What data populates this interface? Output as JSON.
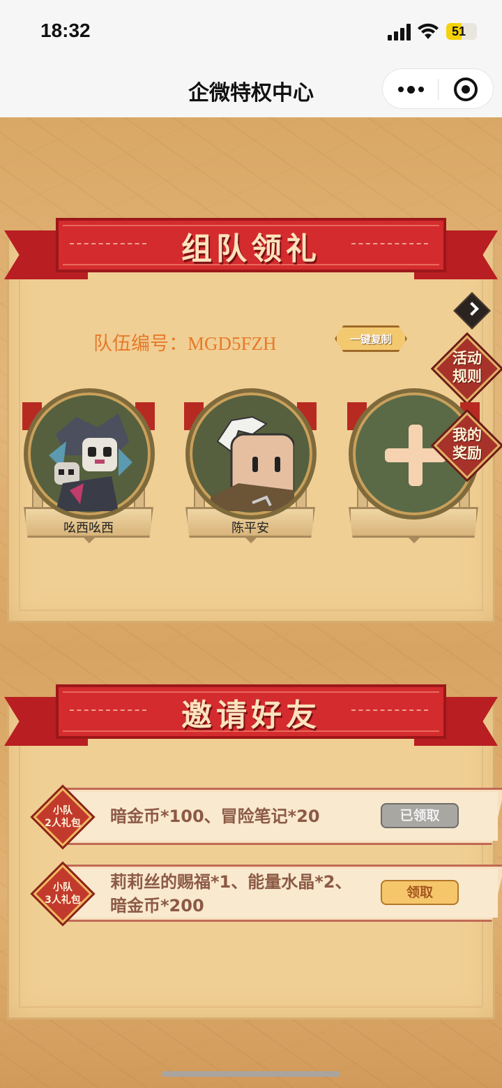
{
  "status_bar": {
    "time": "18:32",
    "battery": "51",
    "battery_level": 0.51
  },
  "nav": {
    "title": "企微特权中心"
  },
  "section_team": {
    "heading": "组队领礼",
    "team_code_label": "队伍编号：MGD5FZH",
    "copy_button": "一键复制",
    "rules_badge": [
      "活动",
      "规则"
    ],
    "rewards_badge": [
      "我的",
      "奖励"
    ],
    "members": [
      {
        "name": "吆西吆西"
      },
      {
        "name": "陈平安"
      },
      {
        "name": ""
      }
    ]
  },
  "section_invite": {
    "heading": "邀请好友",
    "rewards": [
      {
        "tag": [
          "小队",
          "2人礼包"
        ],
        "desc_lines": [
          "暗金币*100、冒险笔记*20"
        ],
        "button": "已领取",
        "state": "claimed"
      },
      {
        "tag": [
          "小队",
          "3人礼包"
        ],
        "desc_lines": [
          "莉莉丝的赐福*1、能量水晶*2、",
          "暗金币*200"
        ],
        "button": "领取",
        "state": "available"
      }
    ]
  },
  "colors": {
    "ribbon": "#d42b2e",
    "panel": "#f0cf94",
    "code_text": "#e67a2b",
    "claim_button": "#f5c66a",
    "claimed_button": "#a9a7a2"
  }
}
